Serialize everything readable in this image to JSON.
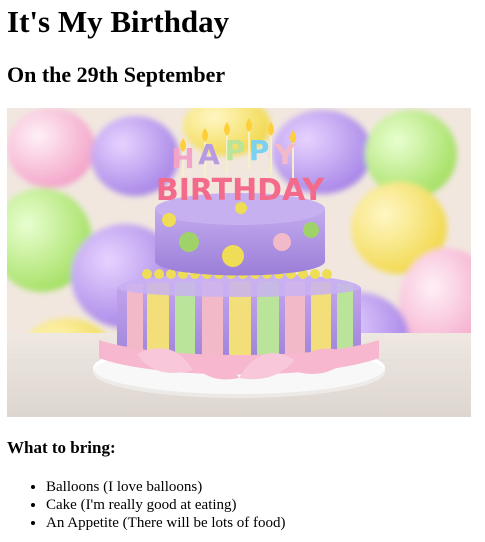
{
  "page": {
    "title": "It's My Birthday",
    "subtitle": "On the 29th September"
  },
  "image": {
    "kind": "birthday-cake-photo",
    "topper_line1": "HAPPY",
    "topper_line2": "BIRTHDAY",
    "colors": {
      "background": "#f1e7df",
      "cake_purple": "#b79be0",
      "cake_pink": "#f2b9c8",
      "stripe_yellow": "#f2df7a",
      "stripe_green": "#b9e49a",
      "dot_yellow": "#eedd55",
      "dot_green": "#9fd36a",
      "board": "#ffffff"
    }
  },
  "bring": {
    "heading": "What to bring:",
    "items": [
      "Balloons (I love balloons)",
      "Cake (I'm really good at eating)",
      "An Appetite (There will be lots of food)"
    ]
  }
}
